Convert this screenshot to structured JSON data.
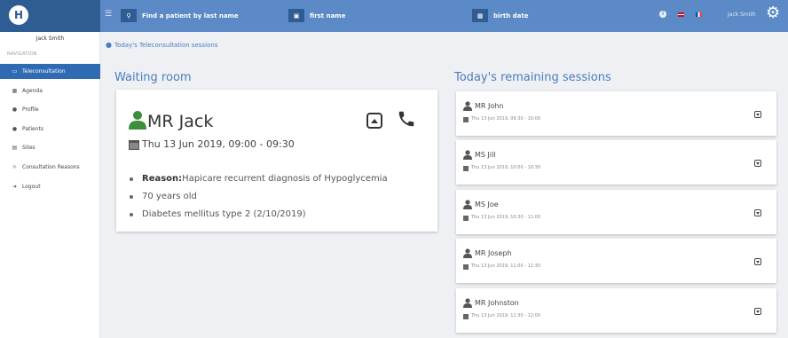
{
  "header": {
    "logo_text": "H",
    "menu_icon": "hamburger-icon",
    "search": [
      {
        "icon": "search-icon",
        "label": "Find a patient by last name"
      },
      {
        "icon": "id-card-icon",
        "label": "first name"
      },
      {
        "icon": "calendar-icon",
        "label": "birth date"
      }
    ],
    "info_icon": "info-icon",
    "user": "Jack Smith",
    "settings_icon": "gears-icon"
  },
  "sidebar": {
    "user": "Jack Smith",
    "section": "NAVIGATION",
    "items": [
      {
        "label": "Teleconsultation",
        "icon": "monitor-icon",
        "active": true
      },
      {
        "label": "Agenda",
        "icon": "calendar-icon"
      },
      {
        "label": "Profile",
        "icon": "user-icon"
      },
      {
        "label": "Patients",
        "icon": "users-icon"
      },
      {
        "label": "Sites",
        "icon": "building-icon"
      },
      {
        "label": "Consultation Reasons",
        "icon": "stethoscope-icon"
      },
      {
        "label": "Logout",
        "icon": "logout-icon"
      }
    ]
  },
  "breadcrumb": "Today's Teleconsultation sessions",
  "waiting_room": {
    "title": "Waiting room",
    "patient": "MR Jack",
    "date": "Thu 13 Jun 2019, 09:00 - 09:30",
    "reason_label": "Reason:",
    "reason": "Hapicare recurrent diagnosis of Hypoglycemia",
    "details": [
      "70 years old",
      "Diabetes mellitus type 2 (2/10/2019)"
    ]
  },
  "remaining": {
    "title": "Today's remaining sessions",
    "sessions": [
      {
        "name": "MR John",
        "time": "Thu 13 Jun 2019, 09:30 - 10:00"
      },
      {
        "name": "MS Jill",
        "time": "Thu 13 Jun 2019, 10:00 - 10:30"
      },
      {
        "name": "MS Joe",
        "time": "Thu 13 Jun 2019, 10:30 - 11:00"
      },
      {
        "name": "MR Joseph",
        "time": "Thu 13 Jun 2019, 11:00 - 11:30"
      },
      {
        "name": "MR Johnston",
        "time": "Thu 13 Jun 2019, 11:30 - 12:00"
      }
    ]
  },
  "colors": {
    "accent": "#5b8ac6",
    "sidebar_active": "#2f6bb3",
    "heading": "#4a7ec0",
    "patient_icon": "#3c8d3c"
  }
}
